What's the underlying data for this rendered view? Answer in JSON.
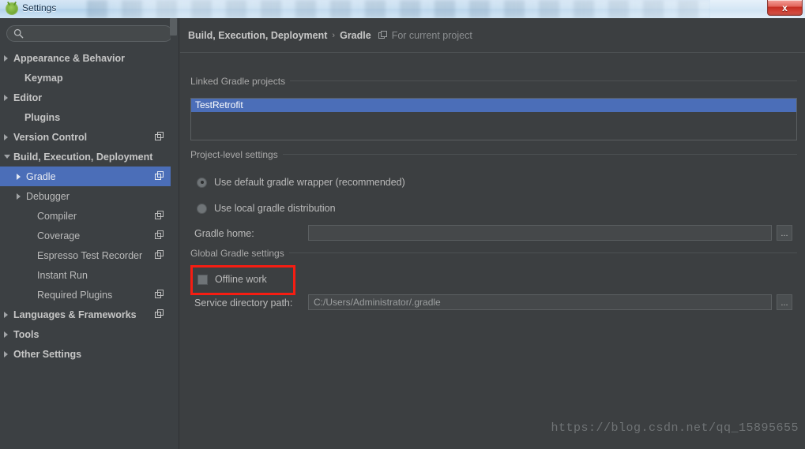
{
  "window": {
    "title": "Settings",
    "app_icon": "android-icon",
    "close_label": "x"
  },
  "sidebar": {
    "search": {
      "value": "",
      "placeholder": "",
      "icon": "search-icon"
    },
    "items": [
      {
        "label": "Appearance & Behavior",
        "arrow": "right",
        "bold": true,
        "indent": 17,
        "selected": false,
        "copy_icon": false
      },
      {
        "label": "Keymap",
        "arrow": "none",
        "bold": true,
        "indent": 31,
        "selected": false,
        "copy_icon": false
      },
      {
        "label": "Editor",
        "arrow": "right",
        "bold": true,
        "indent": 17,
        "selected": false,
        "copy_icon": false
      },
      {
        "label": "Plugins",
        "arrow": "none",
        "bold": true,
        "indent": 31,
        "selected": false,
        "copy_icon": false
      },
      {
        "label": "Version Control",
        "arrow": "right",
        "bold": true,
        "indent": 17,
        "selected": false,
        "copy_icon": true
      },
      {
        "label": "Build, Execution, Deployment",
        "arrow": "down",
        "bold": true,
        "indent": 17,
        "selected": false,
        "copy_icon": false
      },
      {
        "label": "Gradle",
        "arrow": "right",
        "bold": false,
        "indent": 33,
        "selected": true,
        "copy_icon": true
      },
      {
        "label": "Debugger",
        "arrow": "right",
        "bold": false,
        "indent": 33,
        "selected": false,
        "copy_icon": false
      },
      {
        "label": "Compiler",
        "arrow": "none",
        "bold": false,
        "indent": 47,
        "selected": false,
        "copy_icon": true
      },
      {
        "label": "Coverage",
        "arrow": "none",
        "bold": false,
        "indent": 47,
        "selected": false,
        "copy_icon": true
      },
      {
        "label": "Espresso Test Recorder",
        "arrow": "none",
        "bold": false,
        "indent": 47,
        "selected": false,
        "copy_icon": true
      },
      {
        "label": "Instant Run",
        "arrow": "none",
        "bold": false,
        "indent": 47,
        "selected": false,
        "copy_icon": false
      },
      {
        "label": "Required Plugins",
        "arrow": "none",
        "bold": false,
        "indent": 47,
        "selected": false,
        "copy_icon": true
      },
      {
        "label": "Languages & Frameworks",
        "arrow": "right",
        "bold": true,
        "indent": 17,
        "selected": false,
        "copy_icon": true
      },
      {
        "label": "Tools",
        "arrow": "right",
        "bold": true,
        "indent": 17,
        "selected": false,
        "copy_icon": false
      },
      {
        "label": "Other Settings",
        "arrow": "right",
        "bold": true,
        "indent": 17,
        "selected": false,
        "copy_icon": false
      }
    ]
  },
  "main": {
    "breadcrumb": {
      "parent": "Build, Execution, Deployment",
      "separator": "›",
      "current": "Gradle",
      "scope_icon": "project-scope-icon",
      "scope_text": "For current project"
    },
    "groups": {
      "linked_projects": "Linked Gradle projects",
      "project_level": "Project-level settings",
      "global_settings": "Global Gradle settings"
    },
    "linked_projects": [
      {
        "name": "TestRetrofit",
        "selected": true
      }
    ],
    "radios": [
      {
        "label": "Use default gradle wrapper (recommended)",
        "checked": true
      },
      {
        "label": "Use local gradle distribution",
        "checked": false
      }
    ],
    "gradle_home": {
      "label": "Gradle home:",
      "value": "",
      "placeholder": "",
      "browse_label": "..."
    },
    "offline_work": {
      "label": "Offline work",
      "checked": false
    },
    "service_directory": {
      "label": "Service directory path:",
      "value": "C:/Users/Administrator/.gradle",
      "browse_label": "..."
    },
    "annotation": {
      "color": "#f61d12",
      "target": "offline-work-checkbox"
    }
  },
  "watermark": {
    "text": "https://blog.csdn.net/qq_15895655"
  },
  "colors": {
    "selection_blue": "#4b6eb8",
    "panel_bg": "#3c3f41",
    "sidebar_bg": "#3c4043",
    "text": "#bbbbbb",
    "annotation_red": "#f61d12"
  }
}
